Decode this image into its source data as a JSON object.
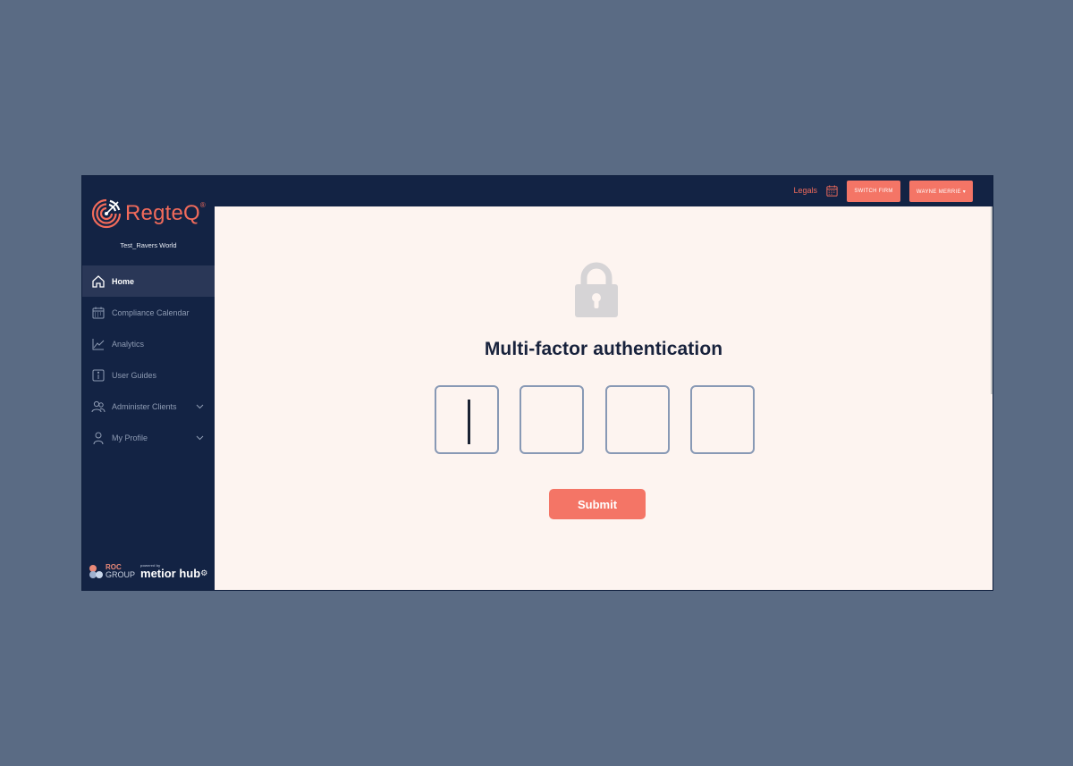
{
  "brand": {
    "name": "RegteQ",
    "registered": "®",
    "firm": "Test_Ravers World",
    "accent_color": "#f26b5b",
    "nav_bg": "#132344"
  },
  "topbar": {
    "legals": "Legals",
    "calendar_icon": "calendar-icon",
    "switch_firm": "SWITCH FIRM",
    "user_menu": "WAYNE MERRIE ▾"
  },
  "sidebar": {
    "items": [
      {
        "label": "Home",
        "icon": "home-icon",
        "active": true
      },
      {
        "label": "Compliance Calendar",
        "icon": "calendar-icon"
      },
      {
        "label": "Analytics",
        "icon": "chart-icon"
      },
      {
        "label": "User Guides",
        "icon": "info-icon"
      },
      {
        "label": "Administer Clients",
        "icon": "users-icon",
        "expandable": true
      },
      {
        "label": "My Profile",
        "icon": "user-icon",
        "expandable": true
      }
    ],
    "footer": {
      "roc": "ROC",
      "group": "GROUP",
      "powered": "powered by",
      "metior": "metior hub"
    }
  },
  "main": {
    "icon": "lock-icon",
    "title": "Multi-factor authentication",
    "code_digits": [
      "",
      "",
      "",
      ""
    ],
    "submit": "Submit"
  }
}
